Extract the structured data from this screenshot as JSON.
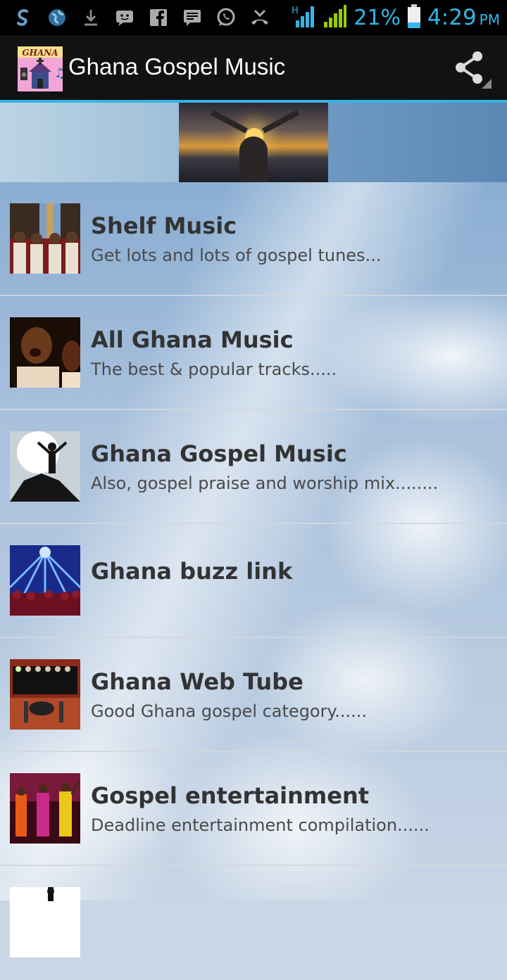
{
  "status_bar": {
    "battery_percent": "21%",
    "time": "4:29",
    "ampm": "PM",
    "icons": [
      "skype-icon",
      "globe-icon",
      "download-icon",
      "message-icon",
      "facebook-icon",
      "chat-icon",
      "whatsapp-icon",
      "missed-call-icon",
      "signal-icon",
      "signal-icon",
      "battery-icon"
    ]
  },
  "action_bar": {
    "title": "Ghana Gospel Music",
    "logo_text": "GHANA",
    "share_icon": "share-icon"
  },
  "list": {
    "items": [
      {
        "title": "Shelf Music",
        "subtitle": "Get lots and lots of gospel tunes..."
      },
      {
        "title": "All Ghana Music",
        "subtitle": "The best & popular tracks....."
      },
      {
        "title": "Ghana Gospel Music",
        "subtitle": "Also, gospel praise and worship mix........"
      },
      {
        "title": "Ghana buzz link",
        "subtitle": ""
      },
      {
        "title": "Ghana Web Tube",
        "subtitle": "Good Ghana gospel category......"
      },
      {
        "title": "Gospel entertainment",
        "subtitle": "Deadline entertainment compilation......"
      }
    ]
  },
  "colors": {
    "accent": "#33b5e5",
    "action_bar_bg": "#111214",
    "title_text": "#333333",
    "subtitle_text": "#4a4a4a"
  }
}
